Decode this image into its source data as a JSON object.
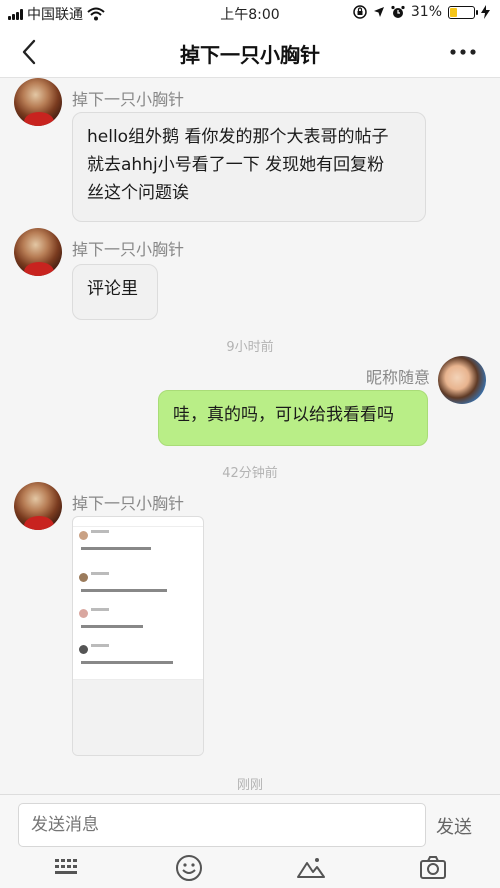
{
  "status_bar": {
    "carrier": "中国联通",
    "time": "上午8:00",
    "battery_percent": "31%",
    "battery_level": 0.31,
    "icons": [
      "signal-icon",
      "wifi-icon",
      "screen-lock-icon",
      "location-arrow-icon",
      "alarm-icon",
      "battery-icon",
      "charging-icon"
    ]
  },
  "nav": {
    "title": "掉下一只小胸针",
    "back_icon": "chevron-left-icon",
    "more_icon": "more-dots-icon"
  },
  "messages": [
    {
      "sender": "掉下一只小胸针",
      "lines": [
        "hello组外鹅 看你发的那个大表哥的帖子",
        "就去ahhj小号看了一下 发现她有回复粉",
        "丝这个问题诶"
      ]
    },
    {
      "sender": "掉下一只小胸针",
      "lines": [
        "评论里"
      ]
    },
    {
      "time": "9小时前"
    },
    {
      "sender": "昵称随意",
      "lines": [
        "哇，真的吗，可以给我看看吗"
      ]
    },
    {
      "time": "42分钟前"
    },
    {
      "sender": "掉下一只小胸针",
      "image": "screenshot-image"
    },
    {
      "time": "刚刚"
    }
  ],
  "composer": {
    "placeholder": "发送消息",
    "send_label": "发送",
    "toolbar_icons": [
      "keyboard-icon",
      "emoji-icon",
      "image-icon",
      "camera-icon"
    ]
  },
  "colors": {
    "my_bubble": "#b9ee87",
    "other_bubble": "#f1f1f1",
    "battery_fill": "#f5c518"
  }
}
